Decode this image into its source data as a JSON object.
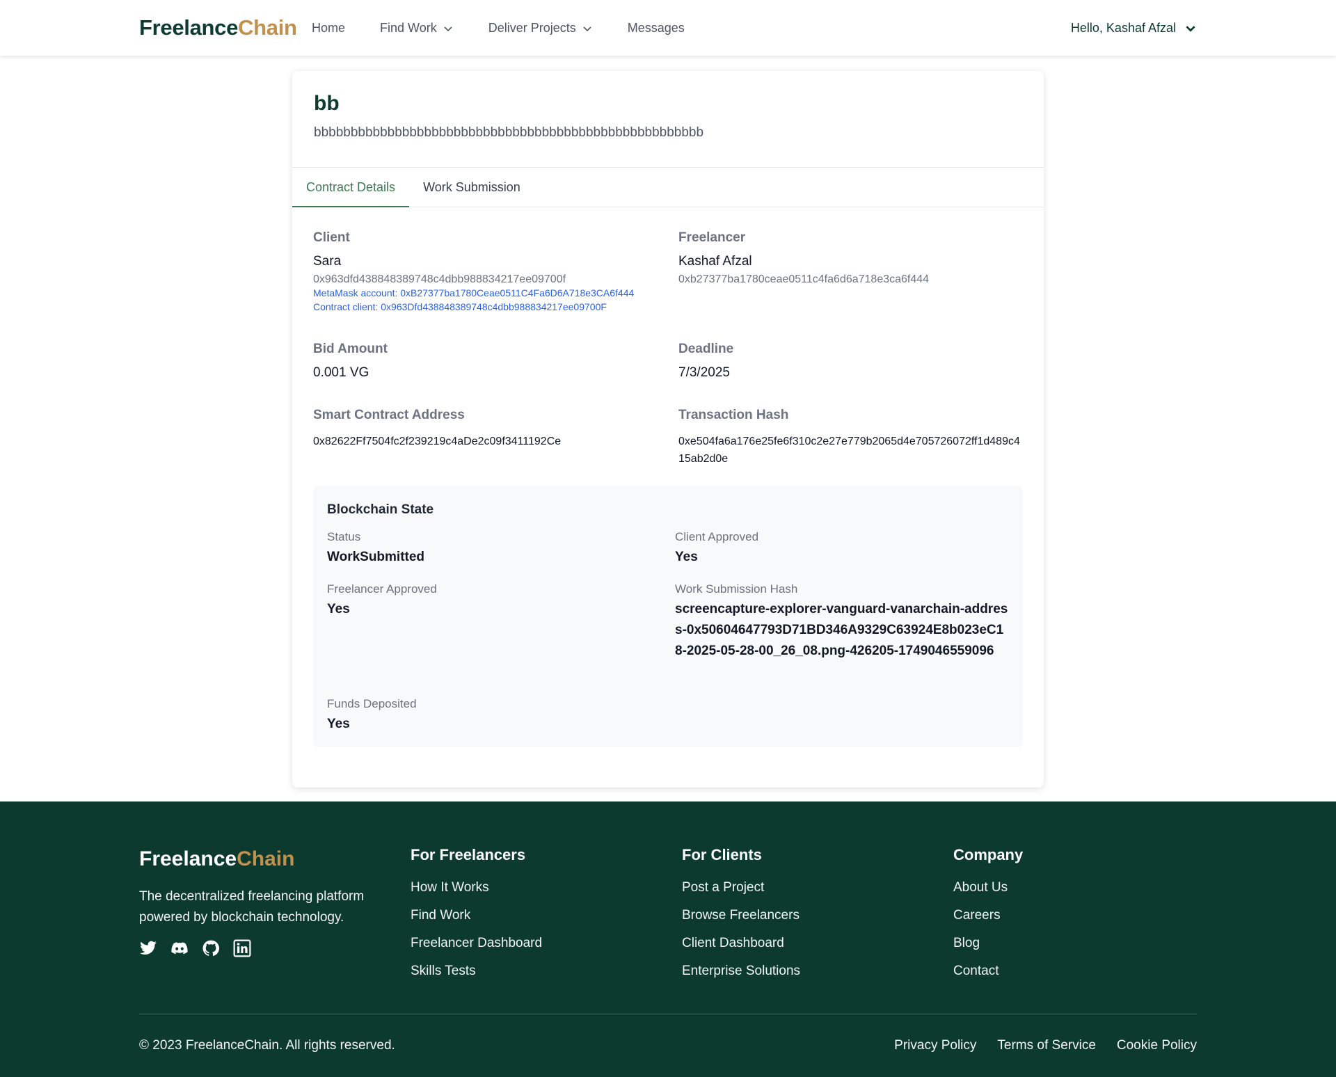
{
  "brand": {
    "part1": "Freelance",
    "part2": "Chain",
    "accent": "#c0904f",
    "primary": "#0d3b2e"
  },
  "nav": {
    "home": "Home",
    "find_work": "Find Work",
    "deliver_projects": "Deliver Projects",
    "messages": "Messages",
    "user_greeting": "Hello, Kashaf Afzal"
  },
  "project": {
    "title": "bb",
    "description": "bbbbbbbbbbbbbbbbbbbbbbbbbbbbbbbbbbbbbbbbbbbbbbbbbbbbb"
  },
  "tabs": {
    "contract_details": "Contract Details",
    "work_submission": "Work Submission"
  },
  "details": {
    "client_label": "Client",
    "client_name": "Sara",
    "client_address": "0x963dfd438848389748c4dbb988834217ee09700f",
    "metamask_account": "MetaMask account: 0xB27377ba1780Ceae0511C4Fa6D6A718e3CA6f444",
    "contract_client": "Contract client: 0x963Dfd438848389748c4dbb988834217ee09700F",
    "freelancer_label": "Freelancer",
    "freelancer_name": "Kashaf Afzal",
    "freelancer_address": "0xb27377ba1780ceae0511c4fa6d6a718e3ca6f444",
    "bid_label": "Bid Amount",
    "bid_value": "0.001 VG",
    "deadline_label": "Deadline",
    "deadline_value": "7/3/2025",
    "contract_label": "Smart Contract Address",
    "contract_value": "0x82622Ff7504fc2f239219c4aDe2c09f3411192Ce",
    "tx_label": "Transaction Hash",
    "tx_value": "0xe504fa6a176e25fe6f310c2e27e779b2065d4e705726072ff1d489c415ab2d0e"
  },
  "blockchain": {
    "title": "Blockchain State",
    "status_label": "Status",
    "status_value": "WorkSubmitted",
    "client_approved_label": "Client Approved",
    "client_approved_value": "Yes",
    "freelancer_approved_label": "Freelancer Approved",
    "freelancer_approved_value": "Yes",
    "work_hash_label": "Work Submission Hash",
    "work_hash_value": "screencapture-explorer-vanguard-vanarchain-address-0x50604647793D71BD346A9329C63924E8b023eC18-2025-05-28-00_26_08.png-426205-1749046559096",
    "funds_label": "Funds Deposited",
    "funds_value": "Yes"
  },
  "footer": {
    "tagline": "The decentralized freelancing platform powered by blockchain technology.",
    "socials": [
      "twitter-icon",
      "discord-icon",
      "github-icon",
      "linkedin-icon"
    ],
    "freelancers": {
      "title": "For Freelancers",
      "links": [
        "How It Works",
        "Find Work",
        "Freelancer Dashboard",
        "Skills Tests"
      ]
    },
    "clients": {
      "title": "For Clients",
      "links": [
        "Post a Project",
        "Browse Freelancers",
        "Client Dashboard",
        "Enterprise Solutions"
      ]
    },
    "company": {
      "title": "Company",
      "links": [
        "About Us",
        "Careers",
        "Blog",
        "Contact"
      ]
    },
    "copyright": "© 2023 FreelanceChain. All rights reserved.",
    "legal": [
      "Privacy Policy",
      "Terms of Service",
      "Cookie Policy"
    ]
  }
}
